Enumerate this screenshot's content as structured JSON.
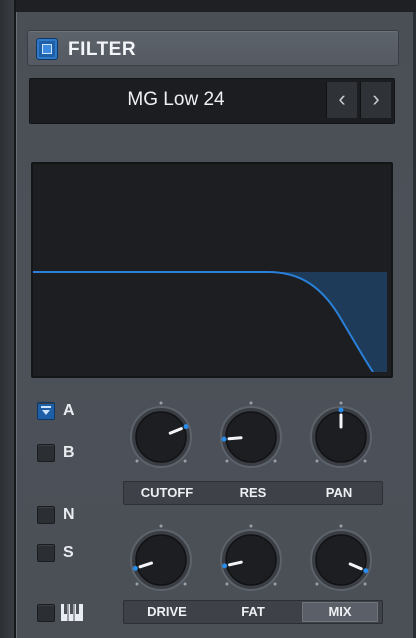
{
  "filter": {
    "title": "FILTER",
    "enabled": true,
    "preset": "MG Low 24",
    "prev_icon": "chevron-left-icon",
    "next_icon": "chevron-right-icon",
    "prev_glyph": "‹",
    "next_glyph": "›"
  },
  "routing": [
    {
      "label": "A",
      "active": true
    },
    {
      "label": "B",
      "active": false
    },
    {
      "label": "N",
      "active": false
    },
    {
      "label": "S",
      "active": false
    },
    {
      "label": "",
      "icon": "keyboard-icon",
      "active": false
    }
  ],
  "knobs_row1": {
    "labels": [
      "CUTOFF",
      "RES",
      "PAN"
    ],
    "values": [
      0.75,
      0.15,
      0.5
    ]
  },
  "knobs_row2": {
    "labels": [
      "DRIVE",
      "FAT",
      "MIX"
    ],
    "values": [
      0.1,
      0.12,
      0.92
    ],
    "active_label": "MIX"
  },
  "colors": {
    "accent": "#1f6fc4",
    "curve": "#2a80d8",
    "curve_fill": "#1f3f5f",
    "panel": "#4b5057"
  }
}
